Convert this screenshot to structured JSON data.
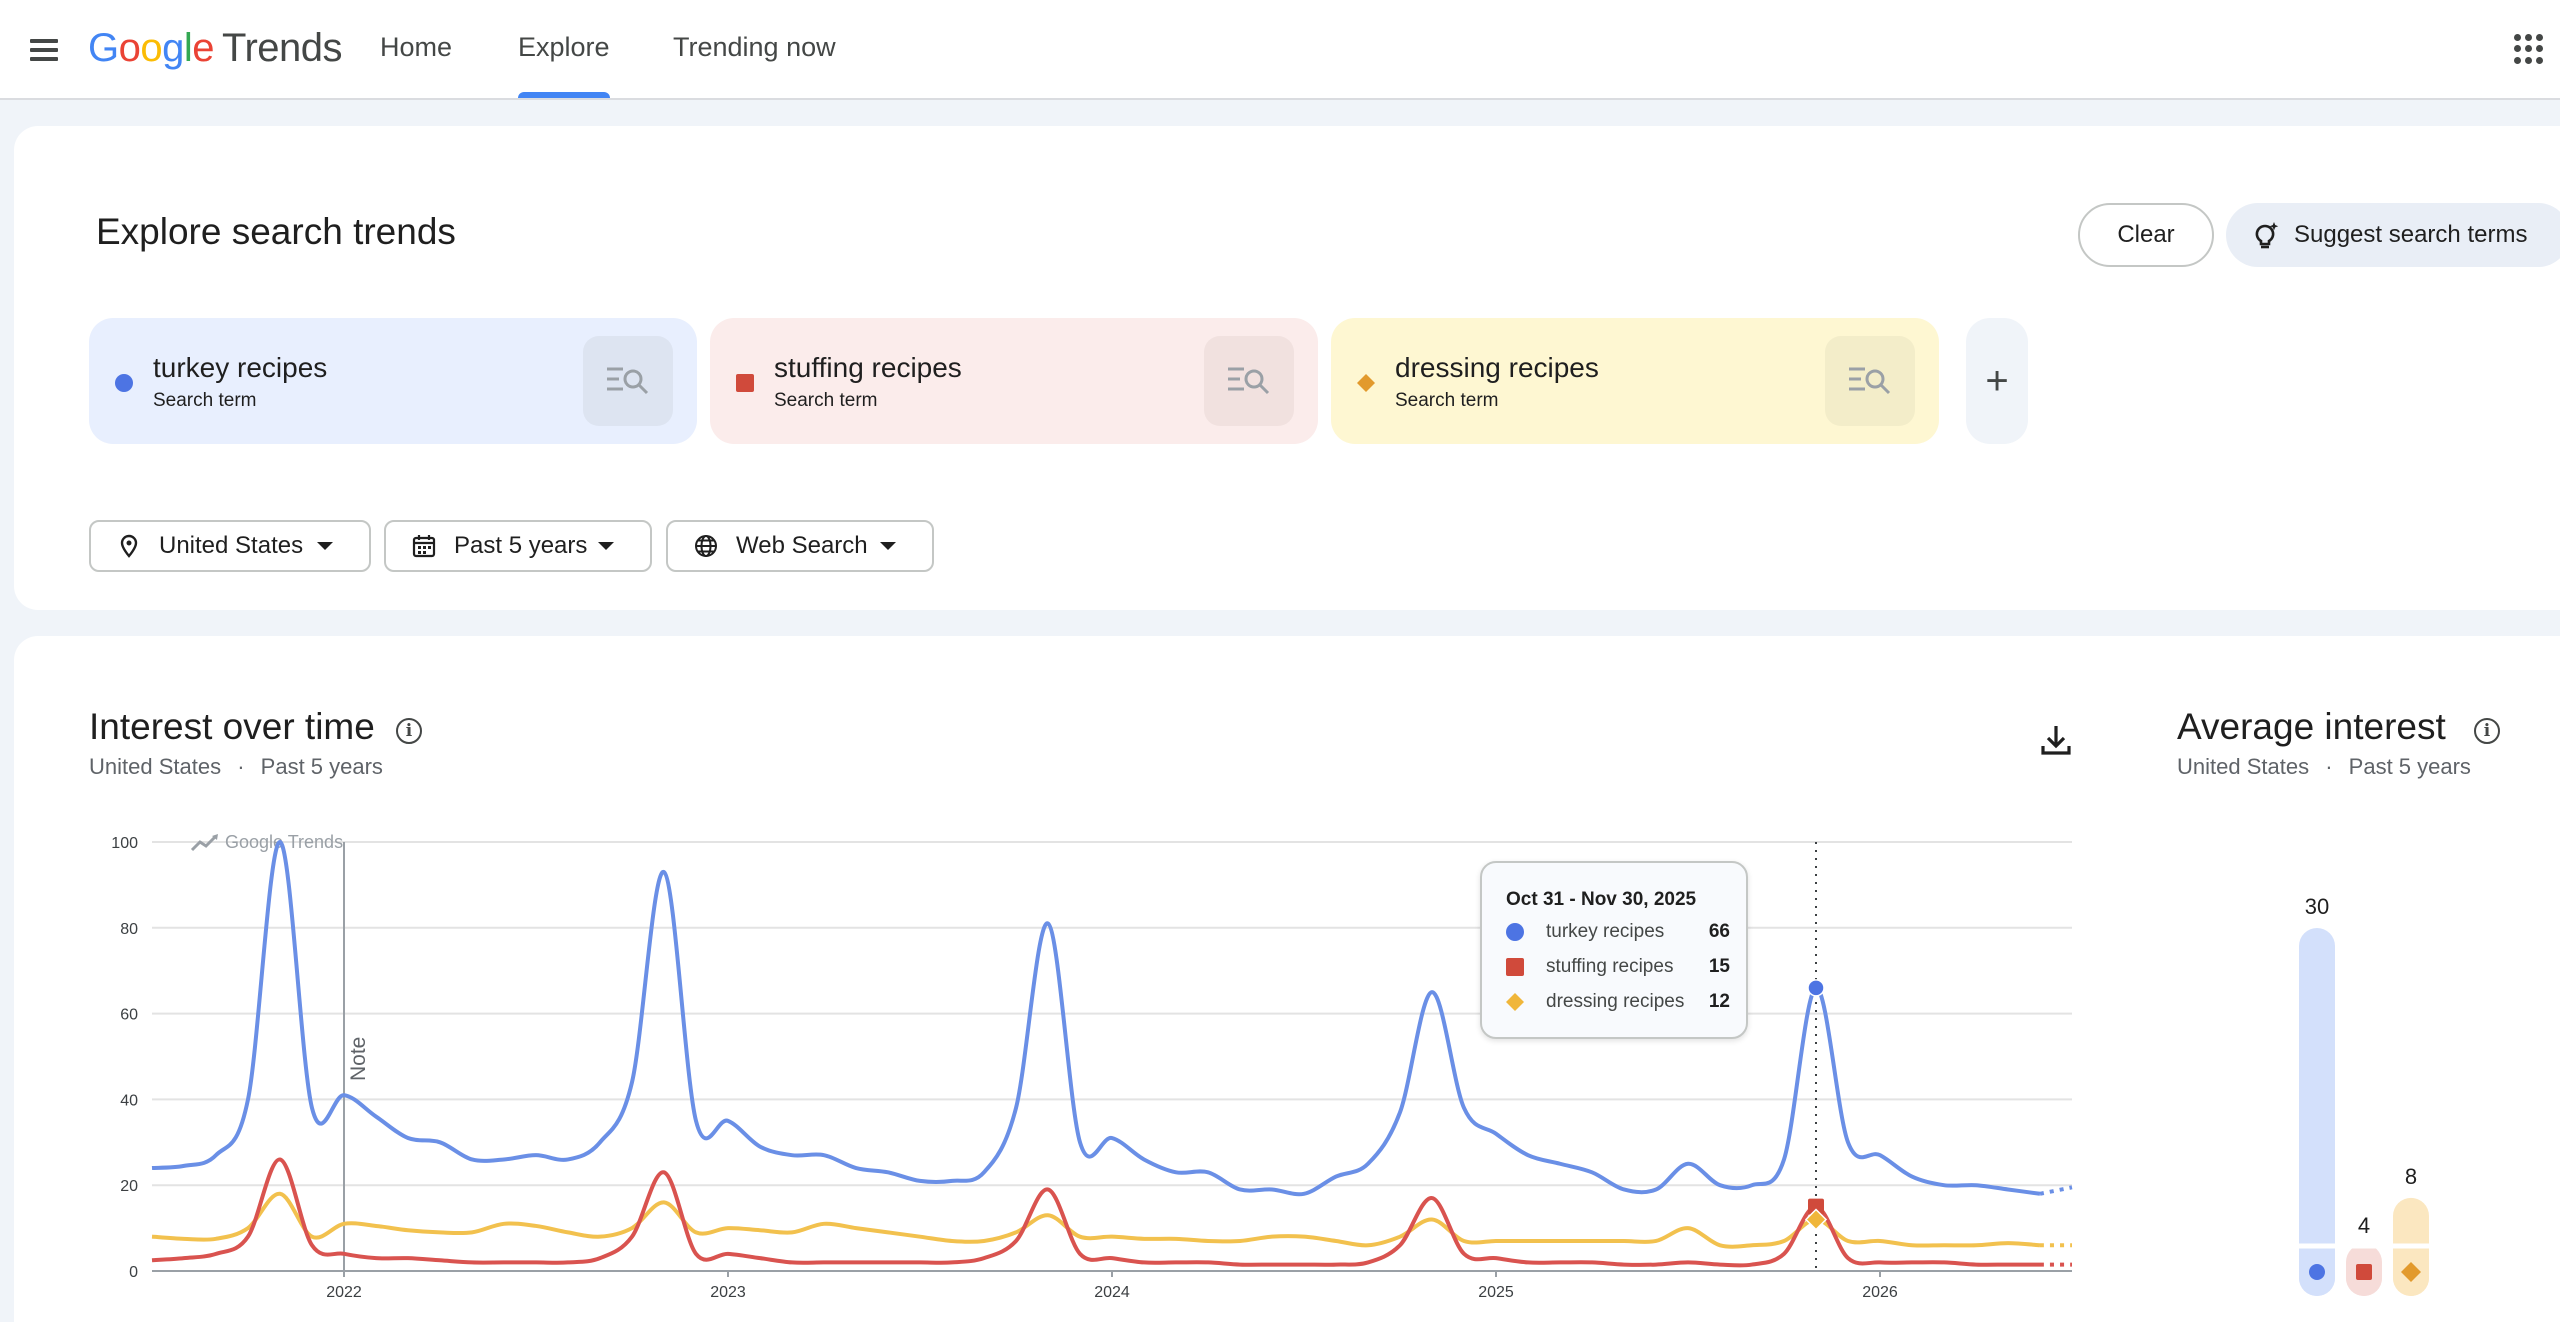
{
  "header": {
    "logo_google": [
      "G",
      "o",
      "o",
      "g",
      "l",
      "e"
    ],
    "logo_product": "Trends",
    "tabs": [
      {
        "label": "Home",
        "active": false
      },
      {
        "label": "Explore",
        "active": true
      },
      {
        "label": "Trending now",
        "active": false
      }
    ]
  },
  "explore": {
    "title": "Explore search trends",
    "clear_label": "Clear",
    "suggest_label": "Suggest search terms",
    "terms": [
      {
        "name": "turkey recipes",
        "type": "Search term",
        "color": "#4d74e3",
        "bg": "#e8effe",
        "marker": "circle"
      },
      {
        "name": "stuffing recipes",
        "type": "Search term",
        "color": "#d04a3b",
        "bg": "#fbeceb",
        "marker": "square"
      },
      {
        "name": "dressing recipes",
        "type": "Search term",
        "color": "#e29a2d",
        "bg": "#fef7d2",
        "marker": "diamond"
      }
    ],
    "add_label": "+",
    "filters": {
      "location": "United States",
      "time": "Past 5 years",
      "property": "Web Search"
    }
  },
  "interest_over_time": {
    "title": "Interest over time",
    "location": "United States",
    "separator": "·",
    "period": "Past 5 years",
    "watermark": "Google Trends",
    "note_label": "Note",
    "tooltip": {
      "date": "Oct 31 - Nov 30, 2025",
      "rows": [
        {
          "label": "turkey recipes",
          "value": "66"
        },
        {
          "label": "stuffing recipes",
          "value": "15"
        },
        {
          "label": "dressing recipes",
          "value": "12"
        }
      ]
    }
  },
  "average_interest": {
    "title": "Average interest",
    "location": "United States",
    "separator": "·",
    "period": "Past 5 years"
  },
  "chart_data": [
    {
      "type": "line",
      "title": "Interest over time",
      "x_tick_labels": [
        "2022",
        "2023",
        "2024",
        "2025",
        "2026"
      ],
      "y_ticks": [
        0,
        20,
        40,
        60,
        80,
        100
      ],
      "ylim": [
        0,
        100
      ],
      "grid": true,
      "x_start": "2021-07",
      "x_end": "2026-07",
      "series": [
        {
          "name": "turkey recipes",
          "color": "#6a8fe6",
          "dot_color": "#4d74e3",
          "points": [
            [
              "2021-07",
              24
            ],
            [
              "2021-08",
              24.5
            ],
            [
              "2021-09",
              27
            ],
            [
              "2021-10",
              40
            ],
            [
              "2021-11",
              100
            ],
            [
              "2021-12",
              38
            ],
            [
              "2022-01",
              41
            ],
            [
              "2022-02",
              36
            ],
            [
              "2022-03",
              31
            ],
            [
              "2022-04",
              30
            ],
            [
              "2022-05",
              26
            ],
            [
              "2022-06",
              26
            ],
            [
              "2022-07",
              27
            ],
            [
              "2022-08",
              26
            ],
            [
              "2022-09",
              30
            ],
            [
              "2022-10",
              44
            ],
            [
              "2022-11",
              93
            ],
            [
              "2022-12",
              35
            ],
            [
              "2023-01",
              35
            ],
            [
              "2023-02",
              29
            ],
            [
              "2023-03",
              27
            ],
            [
              "2023-04",
              27
            ],
            [
              "2023-05",
              24
            ],
            [
              "2023-06",
              23
            ],
            [
              "2023-07",
              21
            ],
            [
              "2023-08",
              21
            ],
            [
              "2023-09",
              23
            ],
            [
              "2023-10",
              38
            ],
            [
              "2023-11",
              81
            ],
            [
              "2023-12",
              30
            ],
            [
              "2024-01",
              31
            ],
            [
              "2024-02",
              26
            ],
            [
              "2024-03",
              23
            ],
            [
              "2024-04",
              23
            ],
            [
              "2024-05",
              19
            ],
            [
              "2024-06",
              19
            ],
            [
              "2024-07",
              18
            ],
            [
              "2024-08",
              22
            ],
            [
              "2024-09",
              25
            ],
            [
              "2024-10",
              37
            ],
            [
              "2024-11",
              65
            ],
            [
              "2024-12",
              38
            ],
            [
              "2025-01",
              32
            ],
            [
              "2025-02",
              27
            ],
            [
              "2025-03",
              25
            ],
            [
              "2025-04",
              23
            ],
            [
              "2025-05",
              19
            ],
            [
              "2025-06",
              19
            ],
            [
              "2025-07",
              25
            ],
            [
              "2025-08",
              20
            ],
            [
              "2025-09",
              20
            ],
            [
              "2025-10",
              26
            ],
            [
              "2025-11",
              66
            ],
            [
              "2025-12",
              30
            ],
            [
              "2026-01",
              27
            ],
            [
              "2026-02",
              22
            ],
            [
              "2026-03",
              20
            ],
            [
              "2026-04",
              20
            ],
            [
              "2026-05",
              19
            ],
            [
              "2026-06",
              18
            ],
            [
              "2026-07",
              19.5
            ]
          ]
        },
        {
          "name": "stuffing recipes",
          "color": "#d9534f",
          "dot_color": "#d04a3b",
          "points": [
            [
              "2021-07",
              2.5
            ],
            [
              "2021-08",
              3
            ],
            [
              "2021-09",
              4
            ],
            [
              "2021-10",
              8
            ],
            [
              "2021-11",
              26
            ],
            [
              "2021-12",
              6
            ],
            [
              "2022-01",
              4
            ],
            [
              "2022-02",
              3
            ],
            [
              "2022-03",
              3
            ],
            [
              "2022-04",
              2.5
            ],
            [
              "2022-05",
              2
            ],
            [
              "2022-06",
              2
            ],
            [
              "2022-07",
              2
            ],
            [
              "2022-08",
              2
            ],
            [
              "2022-09",
              3
            ],
            [
              "2022-10",
              8
            ],
            [
              "2022-11",
              23
            ],
            [
              "2022-12",
              4
            ],
            [
              "2023-01",
              4
            ],
            [
              "2023-02",
              3
            ],
            [
              "2023-03",
              2
            ],
            [
              "2023-04",
              2
            ],
            [
              "2023-05",
              2
            ],
            [
              "2023-06",
              2
            ],
            [
              "2023-07",
              2
            ],
            [
              "2023-08",
              2
            ],
            [
              "2023-09",
              3
            ],
            [
              "2023-10",
              7
            ],
            [
              "2023-11",
              19
            ],
            [
              "2023-12",
              4
            ],
            [
              "2024-01",
              3
            ],
            [
              "2024-02",
              2
            ],
            [
              "2024-03",
              2
            ],
            [
              "2024-04",
              2
            ],
            [
              "2024-05",
              1.5
            ],
            [
              "2024-06",
              1.5
            ],
            [
              "2024-07",
              1.5
            ],
            [
              "2024-08",
              1.5
            ],
            [
              "2024-09",
              2
            ],
            [
              "2024-10",
              6
            ],
            [
              "2024-11",
              17
            ],
            [
              "2024-12",
              4
            ],
            [
              "2025-01",
              3
            ],
            [
              "2025-02",
              2
            ],
            [
              "2025-03",
              2
            ],
            [
              "2025-04",
              2
            ],
            [
              "2025-05",
              1.5
            ],
            [
              "2025-06",
              1.5
            ],
            [
              "2025-07",
              2
            ],
            [
              "2025-08",
              1.5
            ],
            [
              "2025-09",
              1.5
            ],
            [
              "2025-10",
              4
            ],
            [
              "2025-11",
              15
            ],
            [
              "2025-12",
              3
            ],
            [
              "2026-01",
              2
            ],
            [
              "2026-02",
              2
            ],
            [
              "2026-03",
              2
            ],
            [
              "2026-04",
              1.5
            ],
            [
              "2026-05",
              1.5
            ],
            [
              "2026-06",
              1.5
            ],
            [
              "2026-07",
              1.5
            ]
          ]
        },
        {
          "name": "dressing recipes",
          "color": "#f2c14e",
          "dot_color": "#f0b63a",
          "points": [
            [
              "2021-07",
              8
            ],
            [
              "2021-08",
              7.5
            ],
            [
              "2021-09",
              7.5
            ],
            [
              "2021-10",
              10
            ],
            [
              "2021-11",
              18
            ],
            [
              "2021-12",
              8
            ],
            [
              "2022-01",
              11
            ],
            [
              "2022-02",
              10.5
            ],
            [
              "2022-03",
              9.5
            ],
            [
              "2022-04",
              9
            ],
            [
              "2022-05",
              9
            ],
            [
              "2022-06",
              11
            ],
            [
              "2022-07",
              10.5
            ],
            [
              "2022-08",
              9
            ],
            [
              "2022-09",
              8
            ],
            [
              "2022-10",
              10
            ],
            [
              "2022-11",
              16
            ],
            [
              "2022-12",
              9
            ],
            [
              "2023-01",
              10
            ],
            [
              "2023-02",
              9.5
            ],
            [
              "2023-03",
              9
            ],
            [
              "2023-04",
              11
            ],
            [
              "2023-05",
              10
            ],
            [
              "2023-06",
              9
            ],
            [
              "2023-07",
              8
            ],
            [
              "2023-08",
              7
            ],
            [
              "2023-09",
              7
            ],
            [
              "2023-10",
              9
            ],
            [
              "2023-11",
              13
            ],
            [
              "2023-12",
              8
            ],
            [
              "2024-01",
              8
            ],
            [
              "2024-02",
              7.5
            ],
            [
              "2024-03",
              7.5
            ],
            [
              "2024-04",
              7
            ],
            [
              "2024-05",
              7
            ],
            [
              "2024-06",
              8
            ],
            [
              "2024-07",
              8
            ],
            [
              "2024-08",
              7
            ],
            [
              "2024-09",
              6
            ],
            [
              "2024-10",
              8
            ],
            [
              "2024-11",
              12
            ],
            [
              "2024-12",
              7
            ],
            [
              "2025-01",
              7
            ],
            [
              "2025-02",
              7
            ],
            [
              "2025-03",
              7
            ],
            [
              "2025-04",
              7
            ],
            [
              "2025-05",
              7
            ],
            [
              "2025-06",
              7
            ],
            [
              "2025-07",
              10
            ],
            [
              "2025-08",
              6
            ],
            [
              "2025-09",
              6
            ],
            [
              "2025-10",
              7
            ],
            [
              "2025-11",
              12
            ],
            [
              "2025-12",
              7
            ],
            [
              "2026-01",
              7
            ],
            [
              "2026-02",
              6
            ],
            [
              "2026-03",
              6
            ],
            [
              "2026-04",
              6
            ],
            [
              "2026-05",
              6.5
            ],
            [
              "2026-06",
              6
            ],
            [
              "2026-07",
              6
            ]
          ]
        }
      ],
      "note_date": "2022-01",
      "highlight_date": "2025-11"
    },
    {
      "type": "bar",
      "title": "Average interest",
      "categories": [
        "turkey recipes",
        "stuffing recipes",
        "dressing recipes"
      ],
      "values": [
        30,
        4,
        8
      ],
      "value_labels": [
        "30",
        "4",
        "8"
      ],
      "colors": [
        "#d3e0fb",
        "#f6dcd9",
        "#fbe7c0"
      ],
      "dot_colors": [
        "#4d74e3",
        "#d04a3b",
        "#e29a2d"
      ],
      "ylim": [
        0,
        30
      ]
    }
  ]
}
